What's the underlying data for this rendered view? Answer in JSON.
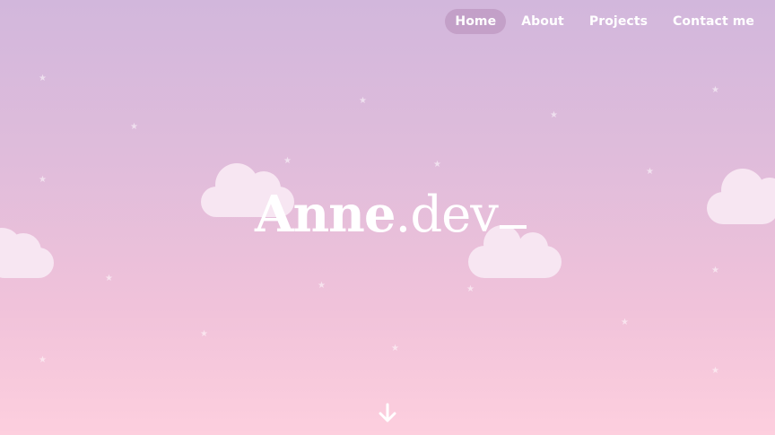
{
  "nav": {
    "items": [
      {
        "label": "Home",
        "active": true
      },
      {
        "label": "About",
        "active": false
      },
      {
        "label": "Projects",
        "active": false
      },
      {
        "label": "Contact me",
        "active": false
      }
    ]
  },
  "hero": {
    "name_bold": "Anne",
    "name_suffix": ".dev",
    "cursor": "_"
  },
  "icons": {
    "scroll": "arrow-down-icon",
    "decor_star": "star-icon",
    "decor_cloud": "cloud-icon"
  },
  "colors": {
    "gradient_top": "#d2b7dc",
    "gradient_bottom": "#fdcfde",
    "text": "#ffffff",
    "active_pill": "#b585b5"
  }
}
